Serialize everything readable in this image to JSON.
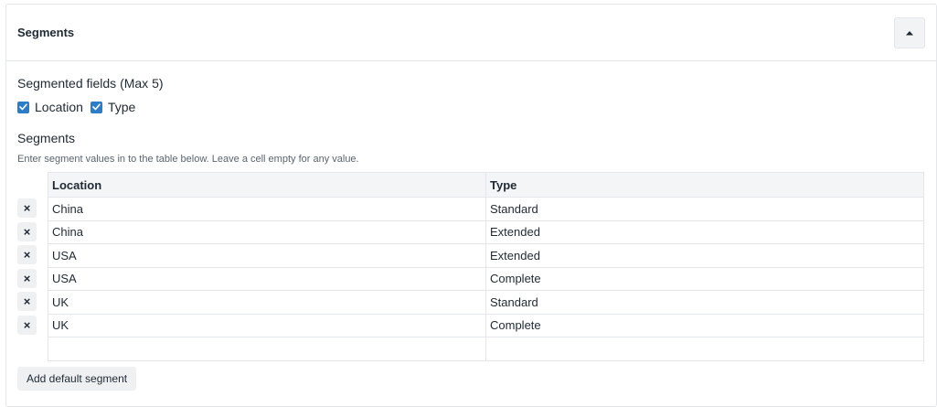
{
  "panel": {
    "title": "Segments"
  },
  "fields": {
    "label": "Segmented fields (Max 5)",
    "options": [
      {
        "label": "Location",
        "checked": true
      },
      {
        "label": "Type",
        "checked": true
      }
    ]
  },
  "segments": {
    "label": "Segments",
    "help": "Enter segment values in to the table below. Leave a cell empty for any value.",
    "columns": [
      "Location",
      "Type"
    ],
    "rows": [
      [
        "China",
        "Standard"
      ],
      [
        "China",
        "Extended"
      ],
      [
        "USA",
        "Extended"
      ],
      [
        "USA",
        "Complete"
      ],
      [
        "UK",
        "Standard"
      ],
      [
        "UK",
        "Complete"
      ],
      [
        "",
        ""
      ]
    ],
    "remove_glyph": "×",
    "add_button": "Add default segment"
  },
  "colors": {
    "accent": "#2b7cc9",
    "border": "#e3e6ea",
    "button_bg": "#eef0f2"
  },
  "icons": {
    "collapse": "caret-up-icon",
    "check": "checkmark-icon",
    "remove": "close-icon"
  }
}
